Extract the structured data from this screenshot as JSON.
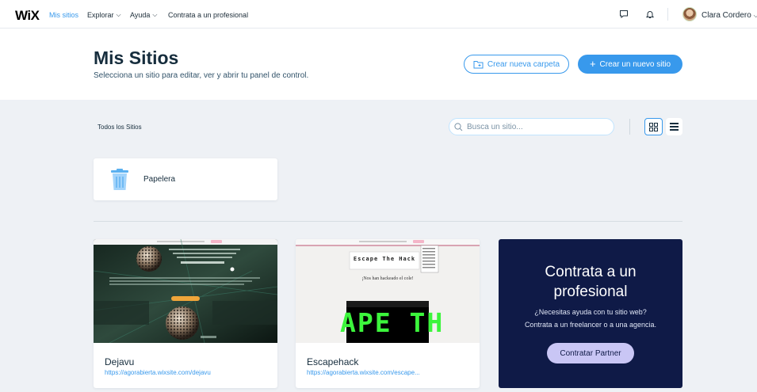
{
  "nav": {
    "logo": "WiX",
    "items": [
      {
        "label": "Mis sitios",
        "active": true
      },
      {
        "label": "Explorar",
        "has_dropdown": true
      },
      {
        "label": "Ayuda",
        "has_dropdown": true
      },
      {
        "label": "Contrata a un profesional"
      }
    ],
    "icons": [
      "chat-icon",
      "bell-icon"
    ],
    "user_name": "Clara Cordero"
  },
  "header": {
    "title": "Mis Sitios",
    "subtitle": "Selecciona un sitio para editar, ver y abrir tu panel de control.",
    "new_folder_label": "Crear nueva carpeta",
    "new_site_label": "Crear un nuevo sitio"
  },
  "toolbar": {
    "all_sites_label": "Todos los Sitios",
    "search_placeholder": "Busca un sitio..."
  },
  "trash": {
    "label": "Papelera"
  },
  "sites": [
    {
      "name": "Dejavu",
      "url": "https://agorabierta.wixsite.com/dejavu"
    },
    {
      "name": "Escapehack",
      "url": "https://agorabierta.wixsite.com/escape..."
    }
  ],
  "promo": {
    "title_line1": "Contrata a un",
    "title_line2": "profesional",
    "desc_line1": "¿Necesitas ayuda con tu sitio web?",
    "desc_line2": "Contrata a un freelancer o a una agencia.",
    "button_label": "Contratar Partner"
  },
  "thumb2": {
    "heading": "Escape The Hack",
    "subheading": "¡Nos han hackeado el cole!",
    "glitch_text": "APE TH"
  },
  "colors": {
    "accent": "#3899ec",
    "navy": "#0f1a47",
    "background": "#eef1f5"
  }
}
